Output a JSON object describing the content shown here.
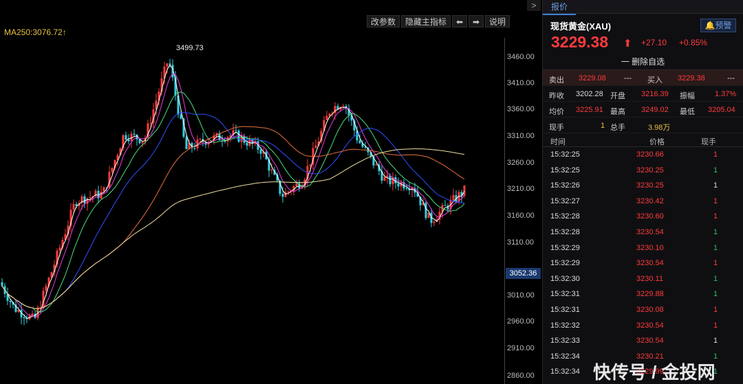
{
  "toolbar": {
    "modify_params": "改参数",
    "hide_indicators": "隐藏主指标",
    "left_arrow": "⬅",
    "right_arrow": "➡",
    "help": "说明",
    "collapse": ">"
  },
  "ma_label": "MA250:3076.72↑",
  "peak_label": "3499.73",
  "price_axis": [
    "3460.00",
    "3410.00",
    "3360.00",
    "3310.00",
    "3260.00",
    "3210.00",
    "3160.00",
    "3110.00",
    "3010.00",
    "2960.00",
    "2910.00",
    "2860.00"
  ],
  "current_axis_price": "3052.36",
  "quote": {
    "tab": "报价",
    "symbol": "现货黄金(XAU)",
    "alert_label": "预警",
    "last_price": "3229.38",
    "arrow": "⬆",
    "change_abs": "+27.10",
    "change_pct": "+0.85%",
    "remove_watch": "一 删除自选",
    "sell_label": "卖出",
    "sell_val": "3229.08",
    "sell_vol": "---",
    "buy_label": "买入",
    "buy_val": "3229.38",
    "buy_vol": "---",
    "prev_close_label": "昨收",
    "prev_close": "3202.28",
    "open_label": "开盘",
    "open": "3216.39",
    "amp_label": "振幅",
    "amp": "1.37%",
    "avg_label": "均价",
    "avg": "3225.91",
    "high_label": "最高",
    "high": "3249.02",
    "low_label": "最低",
    "low": "3205.04",
    "cur_vol_label": "现手",
    "cur_vol": "1",
    "total_vol_label": "总手",
    "total_vol": "3.98万"
  },
  "ticks_header": {
    "time": "时间",
    "price": "价格",
    "vol": "现手"
  },
  "ticks": [
    {
      "time": "15:32:25",
      "price": "3230.66",
      "vol": "1",
      "vc": "red"
    },
    {
      "time": "15:32:25",
      "price": "3230.25",
      "vol": "1",
      "vc": "green"
    },
    {
      "time": "15:32:26",
      "price": "3230.25",
      "vol": "1",
      "vc": "white"
    },
    {
      "time": "15:32:27",
      "price": "3230.42",
      "vol": "1",
      "vc": "red"
    },
    {
      "time": "15:32:28",
      "price": "3230.60",
      "vol": "1",
      "vc": "red"
    },
    {
      "time": "15:32:28",
      "price": "3230.54",
      "vol": "1",
      "vc": "green"
    },
    {
      "time": "15:32:29",
      "price": "3230.10",
      "vol": "1",
      "vc": "green"
    },
    {
      "time": "15:32:29",
      "price": "3230.54",
      "vol": "1",
      "vc": "red"
    },
    {
      "time": "15:32:30",
      "price": "3230.11",
      "vol": "1",
      "vc": "green"
    },
    {
      "time": "15:32:31",
      "price": "3229.88",
      "vol": "1",
      "vc": "green"
    },
    {
      "time": "15:32:31",
      "price": "3230.08",
      "vol": "1",
      "vc": "red"
    },
    {
      "time": "15:32:32",
      "price": "3230.54",
      "vol": "1",
      "vc": "red"
    },
    {
      "time": "15:32:33",
      "price": "3230.54",
      "vol": "1",
      "vc": "white"
    },
    {
      "time": "15:32:34",
      "price": "3230.21",
      "vol": "1",
      "vc": "green"
    },
    {
      "time": "15:32:34",
      "price": "3229.99",
      "vol": "1",
      "vc": "green"
    }
  ],
  "watermark": "快传号 / 金投网",
  "colors": {
    "up": "#ff3b3b",
    "down": "#33d0e0",
    "green": "#22c55e",
    "accent": "#3f7fd6"
  }
}
